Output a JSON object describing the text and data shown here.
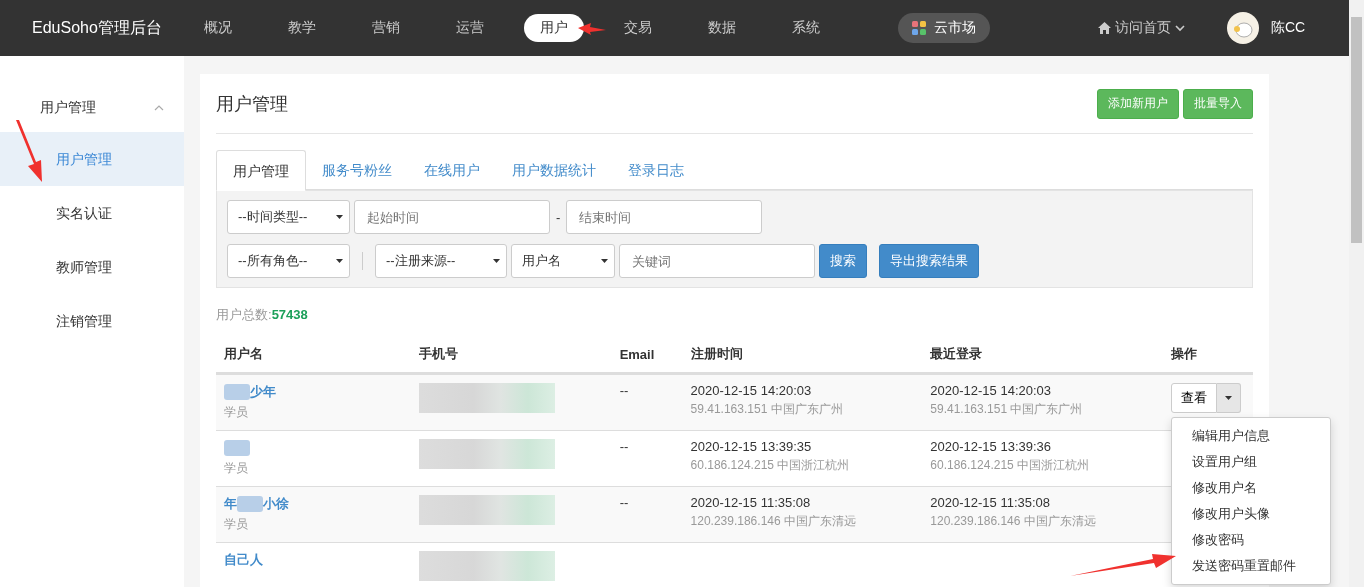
{
  "navbar": {
    "brand": "EduSoho管理后台",
    "items": [
      {
        "label": "概况",
        "selected": false
      },
      {
        "label": "教学",
        "selected": false
      },
      {
        "label": "营销",
        "selected": false
      },
      {
        "label": "运营",
        "selected": false
      },
      {
        "label": "用户",
        "selected": true
      },
      {
        "label": "交易",
        "selected": false
      },
      {
        "label": "数据",
        "selected": false
      },
      {
        "label": "系统",
        "selected": false
      }
    ],
    "market": "云市场",
    "home_link": "访问首页",
    "user": "陈CC"
  },
  "sidebar": {
    "group": {
      "label": "用户管理",
      "expanded": true
    },
    "items": [
      {
        "label": "用户管理",
        "selected": true
      },
      {
        "label": "实名认证",
        "selected": false
      },
      {
        "label": "教师管理",
        "selected": false
      },
      {
        "label": "注销管理",
        "selected": false
      }
    ]
  },
  "page": {
    "title": "用户管理",
    "buttons": [
      "添加新用户",
      "批量导入"
    ],
    "tabs": [
      {
        "label": "用户管理",
        "selected": true
      },
      {
        "label": "服务号粉丝",
        "selected": false
      },
      {
        "label": "在线用户",
        "selected": false
      },
      {
        "label": "用户数据统计",
        "selected": false
      },
      {
        "label": "登录日志",
        "selected": false
      }
    ],
    "filters": {
      "time_type": "--时间类型--",
      "start_placeholder": "起始时间",
      "separator": "-",
      "end_placeholder": "结束时间",
      "role": "--所有角色--",
      "source": "--注册来源--",
      "keyword_type": "用户名",
      "keyword_placeholder": "关键词",
      "search_button": "搜索",
      "export_button": "导出搜索结果"
    },
    "total_label": "用户总数:",
    "total": "57438",
    "table": {
      "columns": [
        "用户名",
        "手机号",
        "Email",
        "注册时间",
        "最近登录",
        "操作"
      ],
      "rows": [
        {
          "name": [
            {
              "kind": "blur"
            },
            {
              "kind": "text",
              "text": "少年"
            }
          ],
          "role": "学员",
          "email": "--",
          "registered": "2020-12-15 14:20:03",
          "registered_ip": "59.41.163.151 中国广东广州",
          "last_login": "2020-12-15 14:20:03",
          "last_login_ip": "59.41.163.151 中国广东广州",
          "action": "查看"
        },
        {
          "name": [
            {
              "kind": "blur"
            }
          ],
          "role": "学员",
          "email": "--",
          "registered": "2020-12-15 13:39:35",
          "registered_ip": "60.186.124.215 中国浙江杭州",
          "last_login": "2020-12-15 13:39:36",
          "last_login_ip": "60.186.124.215 中国浙江杭州"
        },
        {
          "name": [
            {
              "kind": "text",
              "text": "年"
            },
            {
              "kind": "blur"
            },
            {
              "kind": "text",
              "text": "小徐"
            }
          ],
          "role": "学员",
          "email": "--",
          "registered": "2020-12-15 11:35:08",
          "registered_ip": "120.239.186.146 中国广东清远",
          "last_login": "2020-12-15 11:35:08",
          "last_login_ip": "120.239.186.146 中国广东清远"
        },
        {
          "name": [
            {
              "kind": "text",
              "text": "自己人"
            }
          ]
        }
      ]
    },
    "action_menu": [
      "编辑用户信息",
      "设置用户组",
      "修改用户名",
      "修改用户头像",
      "修改密码",
      "发送密码重置邮件"
    ]
  }
}
